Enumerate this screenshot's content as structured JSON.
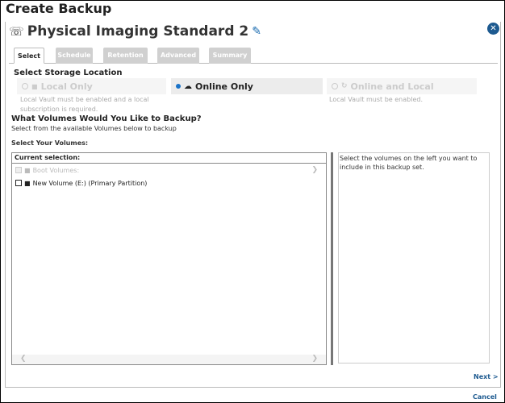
{
  "window": {
    "title": "Create Backup"
  },
  "header": {
    "title": "Physical Imaging Standard 2",
    "icon": "server-icon",
    "edit_icon": "pencil-icon",
    "close_icon": "close-icon"
  },
  "tabs": [
    {
      "label": "Select",
      "active": true
    },
    {
      "label": "Schedule",
      "active": false
    },
    {
      "label": "Retention",
      "active": false
    },
    {
      "label": "Advanced",
      "active": false
    },
    {
      "label": "Summary",
      "active": false
    }
  ],
  "storage": {
    "title": "Select Storage Location",
    "options": [
      {
        "label": "Local Only",
        "icon": "local-drive-icon",
        "selected": false,
        "disabled": true,
        "note": "Local Vault must be enabled and a local subscription is required."
      },
      {
        "label": "Online Only",
        "icon": "cloud-icon",
        "selected": true,
        "disabled": false,
        "note": ""
      },
      {
        "label": "Online and Local",
        "icon": "cloud-local-icon",
        "selected": false,
        "disabled": true,
        "note": "Local Vault must be enabled."
      }
    ]
  },
  "volumes": {
    "title": "What Volumes Would You Like to Backup?",
    "subtitle": "Select from the available Volumes below to backup",
    "select_label": "Select Your Volumes:",
    "list_header": "Current selection:",
    "items": [
      {
        "label": "Boot Volumes:",
        "disabled": true,
        "checked": false
      },
      {
        "label": "New Volume (E:) (Primary Partition)",
        "disabled": false,
        "checked": false
      }
    ],
    "info": "Select the volumes on the left you want to include in this backup set."
  },
  "footer": {
    "next": "Next >",
    "cancel": "Cancel"
  },
  "colors": {
    "accent": "#1d5a90",
    "radio_selected": "#1a73c8"
  }
}
